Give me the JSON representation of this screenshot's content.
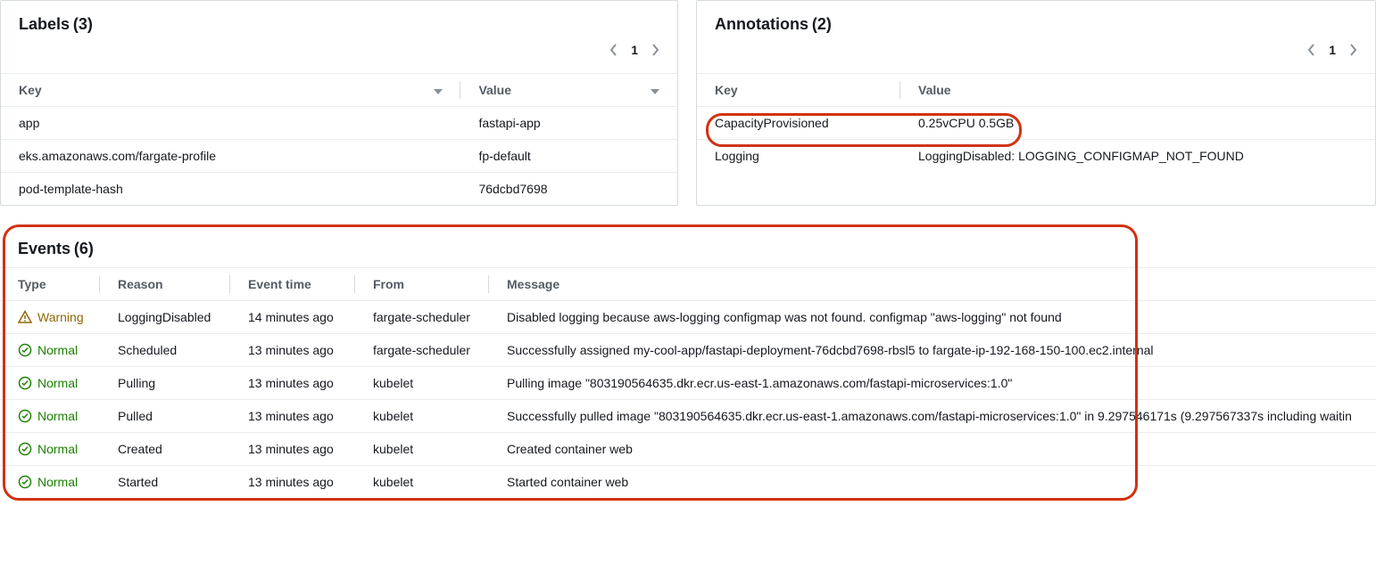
{
  "labels": {
    "title": "Labels",
    "count": "(3)",
    "columns": {
      "key": "Key",
      "value": "Value"
    },
    "page": "1",
    "rows": [
      {
        "key": "app",
        "value": "fastapi-app"
      },
      {
        "key": "eks.amazonaws.com/fargate-profile",
        "value": "fp-default"
      },
      {
        "key": "pod-template-hash",
        "value": "76dcbd7698"
      }
    ]
  },
  "annotations": {
    "title": "Annotations",
    "count": "(2)",
    "columns": {
      "key": "Key",
      "value": "Value"
    },
    "page": "1",
    "rows": [
      {
        "key": "CapacityProvisioned",
        "value": "0.25vCPU 0.5GB"
      },
      {
        "key": "Logging",
        "value": "LoggingDisabled: LOGGING_CONFIGMAP_NOT_FOUND"
      }
    ]
  },
  "events": {
    "title": "Events",
    "count": "(6)",
    "columns": {
      "type": "Type",
      "reason": "Reason",
      "event_time": "Event time",
      "from": "From",
      "message": "Message"
    },
    "rows": [
      {
        "type": "Warning",
        "reason": "LoggingDisabled",
        "event_time": "14 minutes ago",
        "from": "fargate-scheduler",
        "message": "Disabled logging because aws-logging configmap was not found. configmap \"aws-logging\" not found"
      },
      {
        "type": "Normal",
        "reason": "Scheduled",
        "event_time": "13 minutes ago",
        "from": "fargate-scheduler",
        "message": "Successfully assigned my-cool-app/fastapi-deployment-76dcbd7698-rbsl5 to fargate-ip-192-168-150-100.ec2.internal"
      },
      {
        "type": "Normal",
        "reason": "Pulling",
        "event_time": "13 minutes ago",
        "from": "kubelet",
        "message": "Pulling image \"803190564635.dkr.ecr.us-east-1.amazonaws.com/fastapi-microservices:1.0\""
      },
      {
        "type": "Normal",
        "reason": "Pulled",
        "event_time": "13 minutes ago",
        "from": "kubelet",
        "message": "Successfully pulled image \"803190564635.dkr.ecr.us-east-1.amazonaws.com/fastapi-microservices:1.0\" in 9.297546171s (9.297567337s including waitin"
      },
      {
        "type": "Normal",
        "reason": "Created",
        "event_time": "13 minutes ago",
        "from": "kubelet",
        "message": "Created container web"
      },
      {
        "type": "Normal",
        "reason": "Started",
        "event_time": "13 minutes ago",
        "from": "kubelet",
        "message": "Started container web"
      }
    ]
  }
}
